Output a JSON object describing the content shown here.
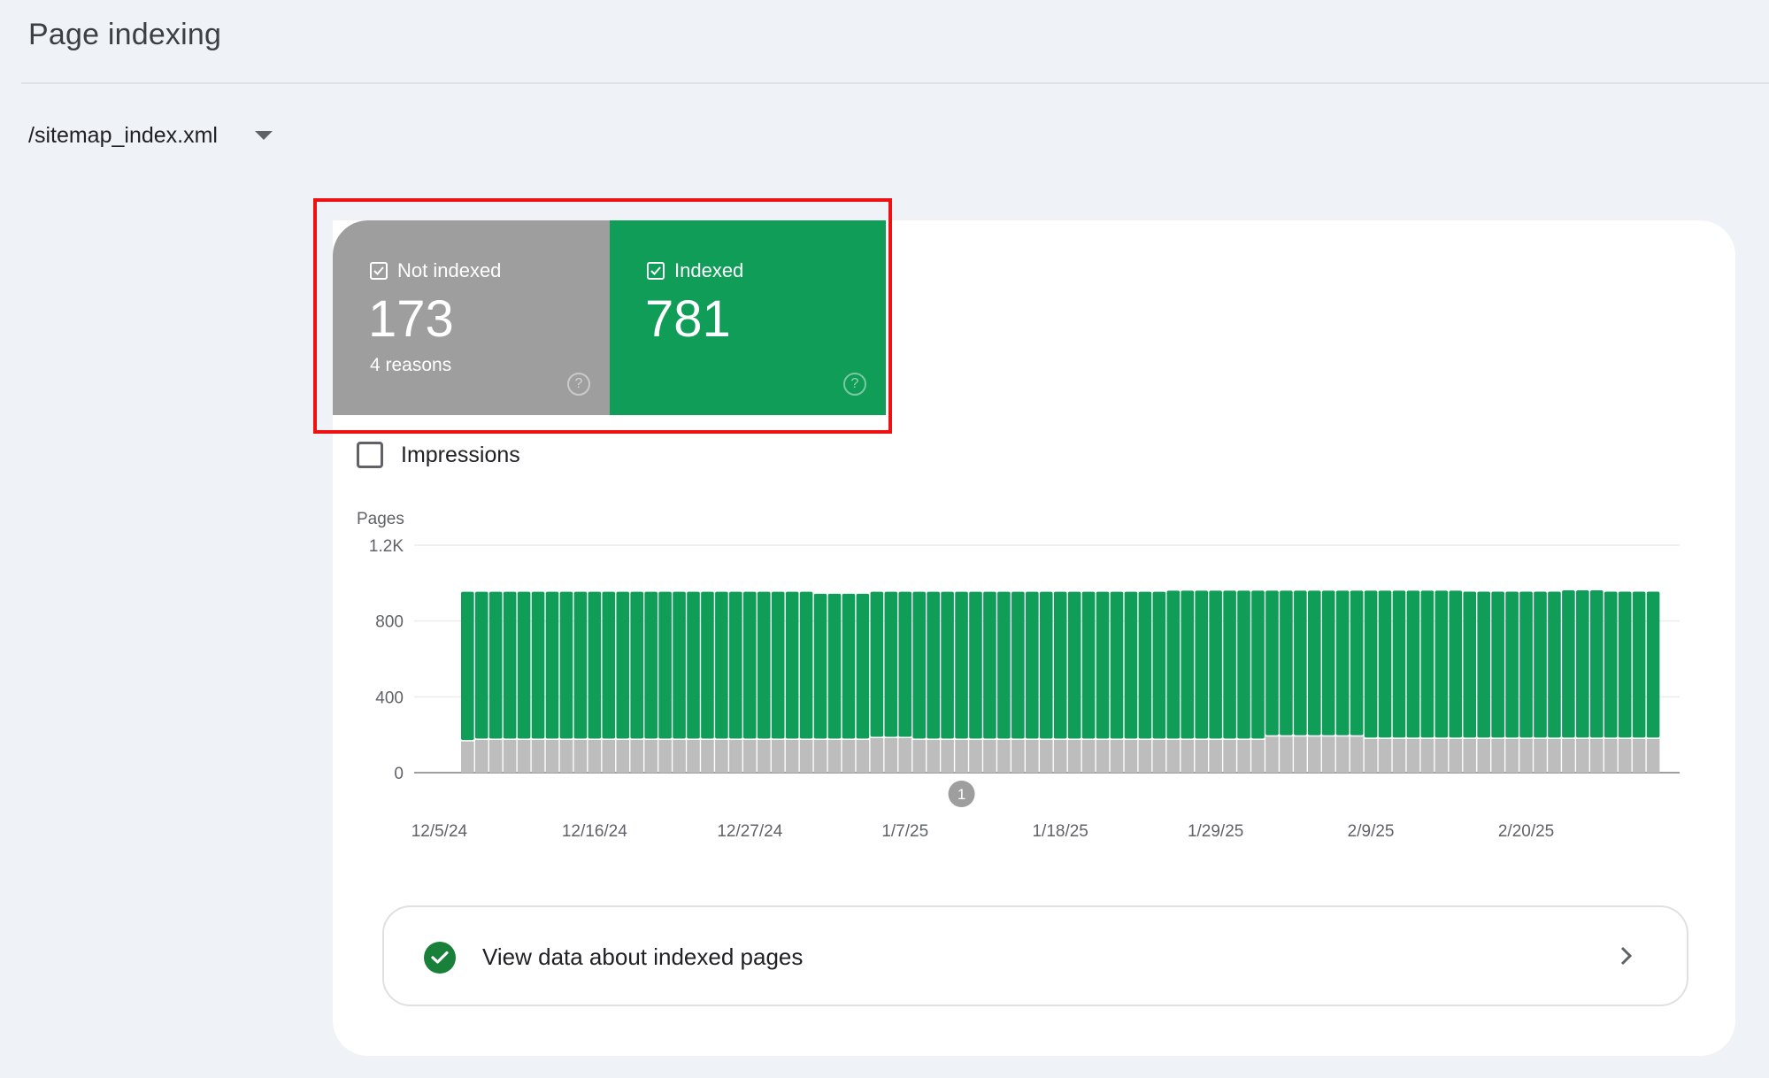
{
  "header": {
    "title": "Page indexing"
  },
  "sitemap_selector": {
    "value": "/sitemap_index.xml",
    "icon": "dropdown-arrow-icon"
  },
  "summary_tiles": [
    {
      "label": "Not indexed",
      "value": "173",
      "subtitle": "4 reasons",
      "checked": true,
      "color": "#9e9e9e",
      "icon": "help-icon"
    },
    {
      "label": "Indexed",
      "value": "781",
      "subtitle": "",
      "checked": true,
      "color": "#0f9d58",
      "icon": "help-icon"
    }
  ],
  "impressions_toggle": {
    "label": "Impressions",
    "checked": false
  },
  "chart_data": {
    "type": "bar",
    "stacked": true,
    "title": "",
    "ylabel": "Pages",
    "xlabel": "",
    "ylim": [
      0,
      1200
    ],
    "yticks": [
      "0",
      "400",
      "800",
      "1.2K"
    ],
    "ytick_values": [
      0,
      400,
      800,
      1200
    ],
    "grid": true,
    "xtick_labels": [
      "12/5/24",
      "12/16/24",
      "12/27/24",
      "1/7/25",
      "1/18/25",
      "1/29/25",
      "2/9/25",
      "2/20/25"
    ],
    "x_start": "12/7/24",
    "x_end": "3/1/25",
    "annotation": {
      "label": "1",
      "date": "1/11/25"
    },
    "series": [
      {
        "name": "Not indexed",
        "color": "#bdbdbd",
        "values": [
          165,
          173,
          173,
          173,
          173,
          173,
          173,
          173,
          173,
          173,
          173,
          173,
          173,
          173,
          173,
          173,
          173,
          173,
          173,
          173,
          173,
          173,
          173,
          173,
          173,
          173,
          173,
          173,
          173,
          182,
          182,
          182,
          173,
          173,
          173,
          173,
          173,
          173,
          173,
          173,
          173,
          173,
          173,
          173,
          173,
          173,
          173,
          173,
          173,
          173,
          173,
          173,
          173,
          173,
          173,
          173,
          173,
          190,
          190,
          190,
          190,
          190,
          190,
          190,
          178,
          178,
          178,
          178,
          178,
          178,
          178,
          178,
          178,
          178,
          178,
          178,
          178,
          178,
          178,
          178,
          178,
          178,
          178,
          178,
          178
        ]
      },
      {
        "name": "Indexed",
        "color": "#0f9d58",
        "values": [
          789,
          781,
          781,
          781,
          781,
          781,
          781,
          781,
          781,
          781,
          781,
          781,
          781,
          781,
          781,
          781,
          781,
          781,
          781,
          781,
          781,
          781,
          781,
          781,
          781,
          771,
          771,
          771,
          771,
          772,
          772,
          772,
          781,
          781,
          781,
          781,
          781,
          781,
          781,
          781,
          781,
          781,
          781,
          781,
          781,
          781,
          781,
          781,
          781,
          781,
          787,
          787,
          787,
          787,
          787,
          787,
          787,
          770,
          770,
          770,
          770,
          770,
          770,
          770,
          782,
          782,
          782,
          782,
          782,
          782,
          782,
          777,
          777,
          777,
          777,
          777,
          777,
          777,
          784,
          784,
          784,
          777,
          777,
          777,
          777
        ]
      }
    ]
  },
  "view_data_link": {
    "label": "View data about indexed pages",
    "icon": "check-circle-icon",
    "chevron": "chevron-right-icon"
  }
}
